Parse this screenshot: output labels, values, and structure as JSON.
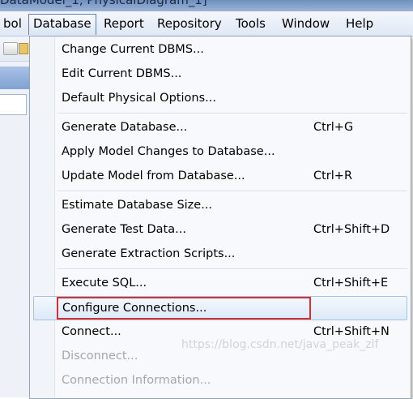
{
  "window": {
    "title": "DataModel_1, PhysicalDiagram_1]"
  },
  "menubar": {
    "items": [
      "bol",
      "Database",
      "Report",
      "Repository",
      "Tools",
      "Window",
      "Help"
    ],
    "active": "Database"
  },
  "dropdown": {
    "items": [
      {
        "label": "Change Current DBMS...",
        "shortcut": ""
      },
      {
        "label": "Edit Current DBMS...",
        "shortcut": ""
      },
      {
        "label": "Default Physical Options...",
        "shortcut": ""
      },
      {
        "label": "Generate Database...",
        "shortcut": "Ctrl+G"
      },
      {
        "label": "Apply Model Changes to Database...",
        "shortcut": ""
      },
      {
        "label": "Update Model from Database...",
        "shortcut": "Ctrl+R"
      },
      {
        "label": "Estimate Database Size...",
        "shortcut": ""
      },
      {
        "label": "Generate Test Data...",
        "shortcut": "Ctrl+Shift+D"
      },
      {
        "label": "Generate Extraction Scripts...",
        "shortcut": ""
      },
      {
        "label": "Execute SQL...",
        "shortcut": "Ctrl+Shift+E"
      },
      {
        "label": "Configure Connections...",
        "shortcut": "",
        "highlighted": true
      },
      {
        "label": "Connect...",
        "shortcut": "Ctrl+Shift+N"
      },
      {
        "label": "Disconnect...",
        "shortcut": "",
        "disabled": true
      },
      {
        "label": "Connection Information...",
        "shortcut": "",
        "disabled": true
      }
    ]
  },
  "watermark": "https://blog.csdn.net/java_peak_zlf",
  "colors": {
    "highlight_border": "#a6c3e6",
    "annotation_box": "#d43030",
    "disabled_text": "#a6a6a6"
  },
  "icons": {
    "toolbar": [
      "copy-icon",
      "folder-icon"
    ]
  }
}
